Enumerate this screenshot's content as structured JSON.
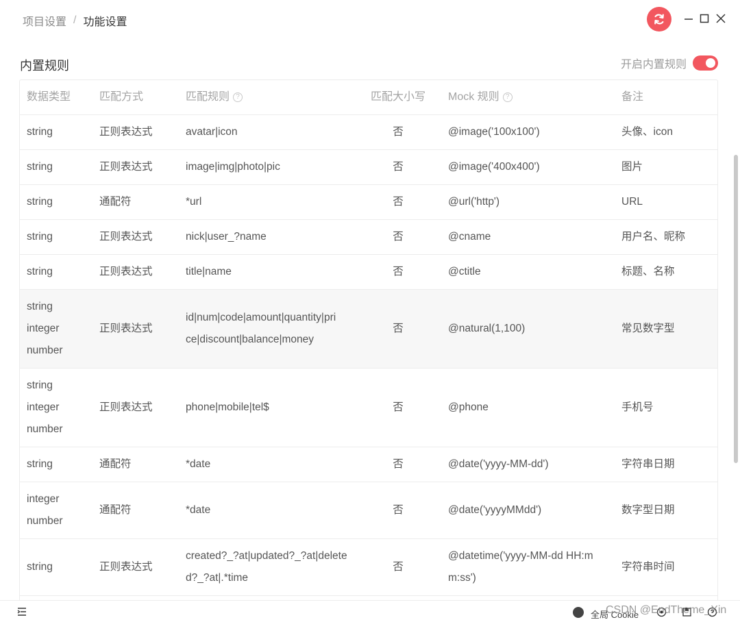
{
  "breadcrumb": {
    "parent": "项目设置",
    "separator": "/",
    "current": "功能设置"
  },
  "section": {
    "title": "内置规则",
    "toggle_label": "开启内置规则",
    "toggle_on": true
  },
  "columns": [
    "数据类型",
    "匹配方式",
    "匹配规则",
    "匹配大小写",
    "Mock 规则",
    "备注"
  ],
  "rows": [
    {
      "types": [
        "string"
      ],
      "method": "正则表达式",
      "rule": [
        "avatar|icon"
      ],
      "case": "否",
      "mock": [
        "@image('100x100')"
      ],
      "note": "头像、icon"
    },
    {
      "types": [
        "string"
      ],
      "method": "正则表达式",
      "rule": [
        "image|img|photo|pic"
      ],
      "case": "否",
      "mock": [
        "@image('400x400')"
      ],
      "note": "图片"
    },
    {
      "types": [
        "string"
      ],
      "method": "通配符",
      "rule": [
        "*url"
      ],
      "case": "否",
      "mock": [
        "@url('http')"
      ],
      "note": "URL"
    },
    {
      "types": [
        "string"
      ],
      "method": "正则表达式",
      "rule": [
        "nick|user_?name"
      ],
      "case": "否",
      "mock": [
        "@cname"
      ],
      "note": "用户名、昵称"
    },
    {
      "types": [
        "string"
      ],
      "method": "正则表达式",
      "rule": [
        "title|name"
      ],
      "case": "否",
      "mock": [
        "@ctitle"
      ],
      "note": "标题、名称"
    },
    {
      "types": [
        "string",
        "integer",
        "number"
      ],
      "method": "正则表达式",
      "rule": [
        "id|num|code|amount|quantity|pri",
        "ce|discount|balance|money"
      ],
      "case": "否",
      "mock": [
        "@natural(1,100)"
      ],
      "note": "常见数字型"
    },
    {
      "types": [
        "string",
        "integer",
        "number"
      ],
      "method": "正则表达式",
      "rule": [
        "phone|mobile|tel$"
      ],
      "case": "否",
      "mock": [
        "@phone"
      ],
      "note": "手机号"
    },
    {
      "types": [
        "string"
      ],
      "method": "通配符",
      "rule": [
        "*date"
      ],
      "case": "否",
      "mock": [
        "@date('yyyy-MM-dd')"
      ],
      "note": "字符串日期"
    },
    {
      "types": [
        "integer",
        "number"
      ],
      "method": "通配符",
      "rule": [
        "*date"
      ],
      "case": "否",
      "mock": [
        "@date('yyyyMMdd')"
      ],
      "note": "数字型日期"
    },
    {
      "types": [
        "string"
      ],
      "method": "正则表达式",
      "rule": [
        "created?_?at|updated?_?at|delete",
        "d?_?at|.*time"
      ],
      "case": "否",
      "mock": [
        "@datetime('yyyy-MM-dd HH:m",
        "m:ss')"
      ],
      "note": "字符串时间"
    }
  ],
  "statusbar": {
    "cookie_label": "全局 Cookie",
    "watermark": "CSDN @EndTheme_Xin"
  },
  "colors": {
    "accent": "#f2575f",
    "border": "#ececec",
    "header_text": "#a3a3a3"
  }
}
